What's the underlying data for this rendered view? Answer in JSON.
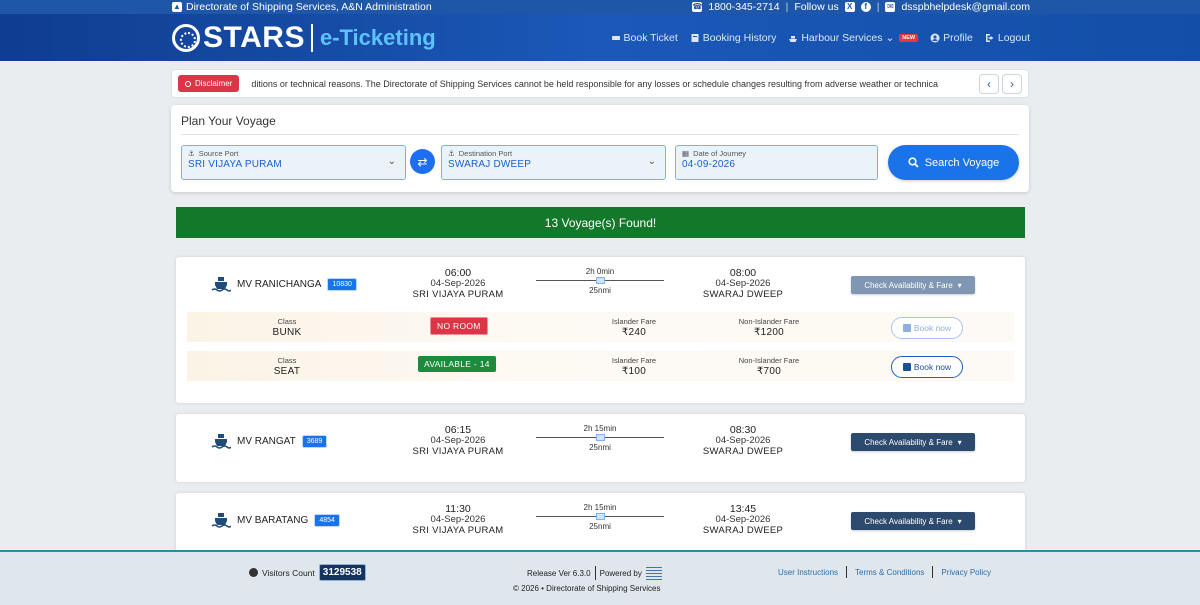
{
  "topbar": {
    "org": "Directorate of Shipping Services, A&N Administration",
    "phone": "1800-345-2714",
    "follow": "Follow us",
    "email": "dsspbhelpdesk@gmail.com"
  },
  "header": {
    "brand": "STARS",
    "brand_sub": "e-Ticketing",
    "nav": [
      {
        "label": "Book Ticket",
        "icon": "ticket-icon"
      },
      {
        "label": "Booking History",
        "icon": "book-icon"
      },
      {
        "label": "Harbour Services",
        "icon": "ship-icon",
        "badge": "NEW"
      },
      {
        "label": "Profile",
        "icon": "user-icon"
      },
      {
        "label": "Logout",
        "icon": "logout-icon"
      }
    ]
  },
  "disclaimer": {
    "label": "Disclaimer",
    "text": "ditions or technical reasons. The Directorate of Shipping Services cannot be held responsible for any losses or schedule changes resulting from adverse weather or technica"
  },
  "plan": {
    "title": "Plan Your Voyage",
    "source_label": "Source Port",
    "source_value": "SRI VIJAYA PURAM",
    "dest_label": "Destination Port",
    "dest_value": "SWARAJ DWEEP",
    "date_label": "Date of Journey",
    "date_value": "04-09-2026",
    "search_label": "Search Voyage"
  },
  "found": "13 Voyage(s) Found!",
  "voyages": [
    {
      "vessel": "MV RANICHANGA",
      "id": "10830",
      "dep_time": "06:00",
      "dep_date": "04-Sep-2026",
      "dep_port": "SRI VIJAYA PURAM",
      "duration": "2h 0min",
      "distance": "25nmi",
      "arr_time": "08:00",
      "arr_date": "04-Sep-2026",
      "arr_port": "SWARAJ DWEEP",
      "check_label": "Check Availability & Fare",
      "classes": [
        {
          "class_label": "Class",
          "class": "BUNK",
          "status": "NO ROOM",
          "islander_label": "Islander Fare",
          "islander": "₹240",
          "non_islander_label": "Non-Islander Fare",
          "non_islander": "₹1200",
          "book": "Book now"
        },
        {
          "class_label": "Class",
          "class": "SEAT",
          "status": "AVAILABLE - 14",
          "islander_label": "Islander Fare",
          "islander": "₹100",
          "non_islander_label": "Non-Islander Fare",
          "non_islander": "₹700",
          "book": "Book now"
        }
      ]
    },
    {
      "vessel": "MV RANGAT",
      "id": "3689",
      "dep_time": "06:15",
      "dep_date": "04-Sep-2026",
      "dep_port": "SRI VIJAYA PURAM",
      "duration": "2h 15min",
      "distance": "25nmi",
      "arr_time": "08:30",
      "arr_date": "04-Sep-2026",
      "arr_port": "SWARAJ DWEEP",
      "check_label": "Check Availability & Fare"
    },
    {
      "vessel": "MV BARATANG",
      "id": "4854",
      "dep_time": "11:30",
      "dep_date": "04-Sep-2026",
      "dep_port": "SRI VIJAYA PURAM",
      "duration": "2h 15min",
      "distance": "25nmi",
      "arr_time": "13:45",
      "arr_date": "04-Sep-2026",
      "arr_port": "SWARAJ DWEEP",
      "check_label": "Check Availability & Fare"
    }
  ],
  "footer": {
    "visitors_label": "Visitors Count",
    "visitors": "3129538",
    "release": "Release Ver 6.3.0",
    "powered": "Powered by",
    "copyright": "© 2026 • Directorate of Shipping Services",
    "links": [
      "User Instructions",
      "Terms & Conditions",
      "Privacy Policy"
    ]
  }
}
